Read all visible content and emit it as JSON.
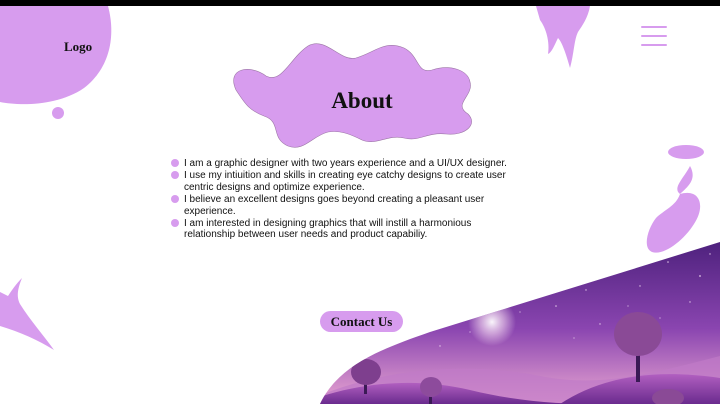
{
  "brand": {
    "logo": "Logo"
  },
  "header": {
    "menu_icon": "hamburger-menu-icon"
  },
  "about": {
    "title": "About",
    "points": [
      "I am a graphic designer with two years experience and a UI/UX designer.",
      "I use my intiuition and skills in creating eye catchy designs to create user centric designs and optimize experience.",
      "I believe an excellent designs goes beyond creating a pleasant user experience.",
      " I am interested in designing graphics that will instill a harmonious relationship between user needs and product capabiliy."
    ]
  },
  "cta": {
    "contact_label": "Contact Us"
  },
  "colors": {
    "accent": "#d79cee",
    "background": "#ffffff",
    "text": "#111111",
    "night_sky": "#6b2d94"
  }
}
